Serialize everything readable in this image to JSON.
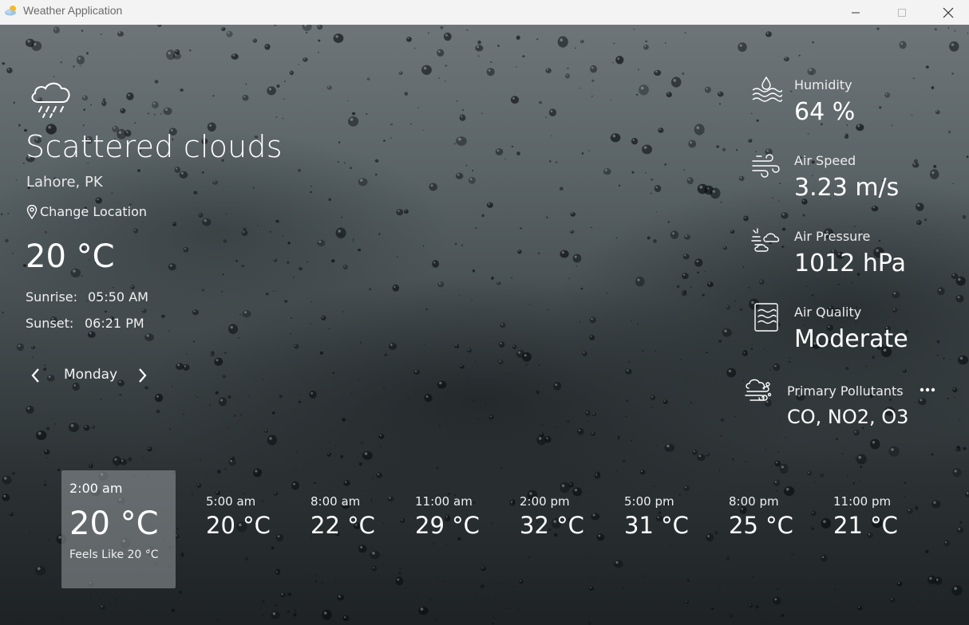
{
  "window": {
    "title": "Weather Application"
  },
  "current": {
    "condition": "Scattered clouds",
    "location": "Lahore, PK",
    "change_location_label": "Change Location",
    "temperature": "20 °C",
    "sunrise_label": "Sunrise:",
    "sunrise_time": "05:50 AM",
    "sunset_label": "Sunset:",
    "sunset_time": "06:21 PM",
    "icon": "rain-cloud-icon"
  },
  "day_nav": {
    "day": "Monday"
  },
  "stats": {
    "humidity": {
      "label": "Humidity",
      "value": "64 %",
      "icon": "humidity-icon"
    },
    "air_speed": {
      "label": "Air Speed",
      "value": "3.23 m/s",
      "icon": "wind-icon"
    },
    "air_pressure": {
      "label": "Air Pressure",
      "value": "1012 hPa",
      "icon": "pressure-icon"
    },
    "air_quality": {
      "label": "Air Quality",
      "value": "Moderate",
      "icon": "air-quality-icon"
    },
    "pollutants": {
      "label": "Primary Pollutants",
      "value": "CO, NO2, O3",
      "icon": "smog-icon"
    }
  },
  "hourly": {
    "selected": {
      "time": "2:00 am",
      "temp": "20 °C",
      "feels_like": "Feels Like 20 °C"
    },
    "items": [
      {
        "time": "5:00 am",
        "temp": "20 °C"
      },
      {
        "time": "8:00 am",
        "temp": "22 °C"
      },
      {
        "time": "11:00 am",
        "temp": "29 °C"
      },
      {
        "time": "2:00 pm",
        "temp": "32 °C"
      },
      {
        "time": "5:00 pm",
        "temp": "31 °C"
      },
      {
        "time": "8:00 pm",
        "temp": "25 °C"
      },
      {
        "time": "11:00 pm",
        "temp": "21 °C"
      }
    ]
  },
  "colors": {
    "titlebar_bg": "#f3f3f3",
    "text": "#ffffff",
    "card_bg": "#969b9e"
  }
}
